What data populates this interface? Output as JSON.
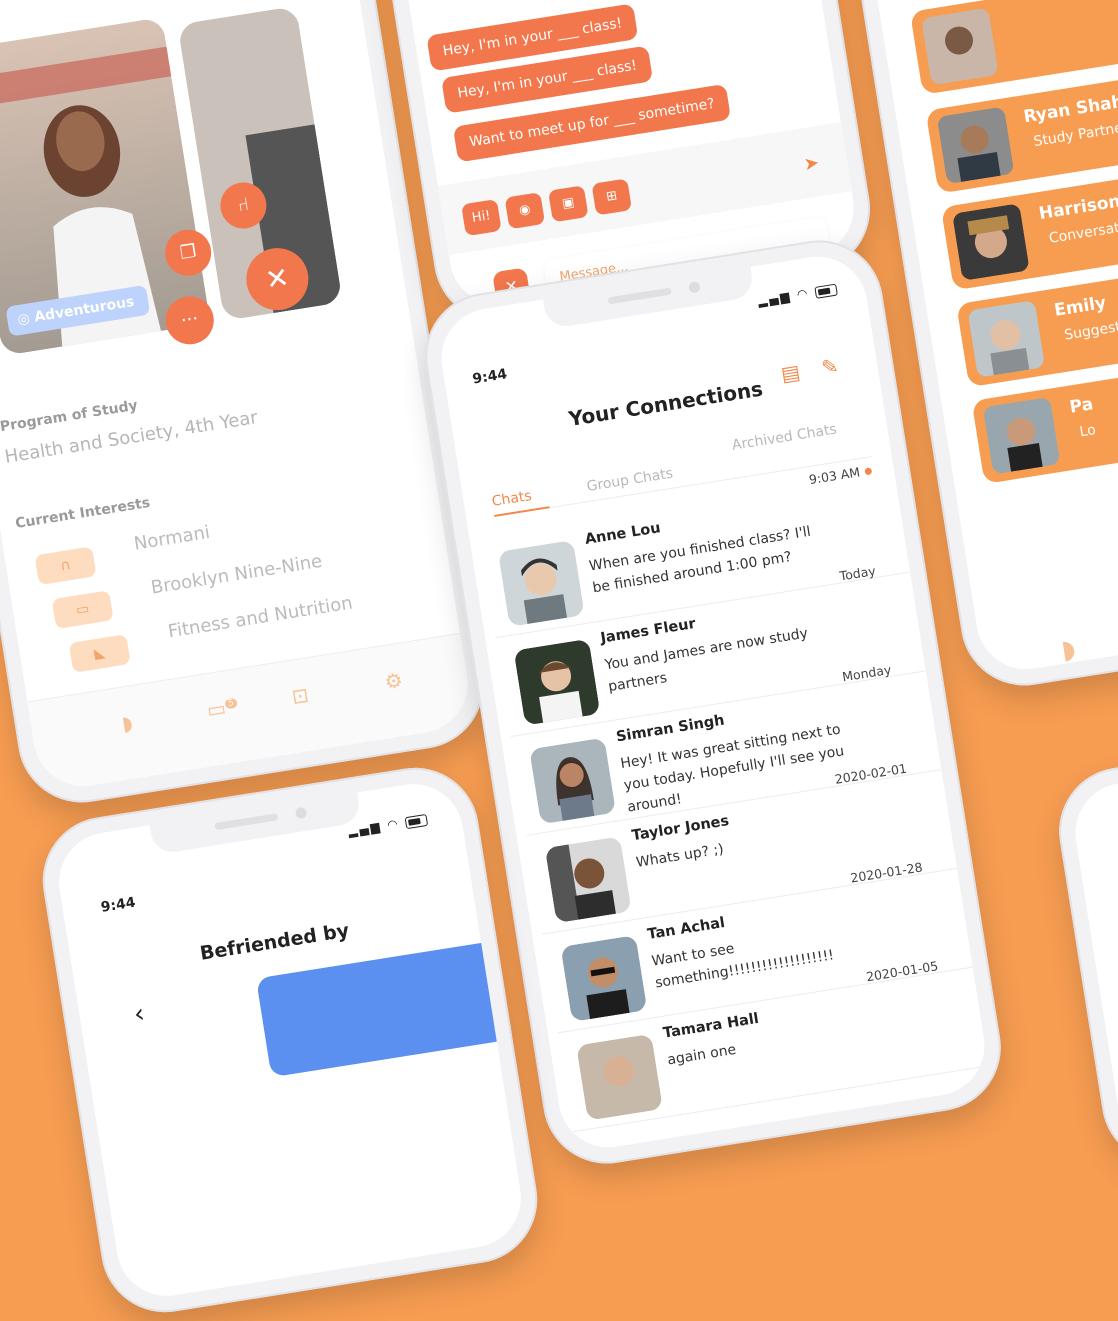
{
  "colors": {
    "background": "#f79d52",
    "accent": "#f2774d",
    "accent_light": "#fddcbf",
    "chip_blue": "#bdd3fb",
    "blue_panel": "#5b8ff0"
  },
  "profile": {
    "tag": "Adventurous",
    "program_label": "Program of Study",
    "program_value": "Health and Society, 4th Year",
    "interests_label": "Current Interests",
    "interests": [
      {
        "icon": "headphones-icon",
        "label": "Normani"
      },
      {
        "icon": "tv-icon",
        "label": "Brooklyn Nine-Nine"
      },
      {
        "icon": "sneaker-icon",
        "label": "Fitness and Nutrition"
      }
    ],
    "nav_badge": "5"
  },
  "compose": {
    "bubbles": [
      "Hey, I'm in your ___ class!",
      "Want to meet up for ___ sometime?"
    ],
    "partial_bubble": "Hey, I'm in your ___ class!",
    "tools": [
      "Hi!",
      "camera-icon",
      "image-icon",
      "file-plus-icon"
    ],
    "input_placeholder": "Message..."
  },
  "suggestions": [
    {
      "name": "Ryan Shah",
      "subtitle": "Study Partner"
    },
    {
      "name": "Harrison",
      "subtitle": "Conversation"
    },
    {
      "name": "Emily",
      "subtitle": "Suggested"
    },
    {
      "name": "Pa",
      "subtitle": "Lo"
    }
  ],
  "connections": {
    "time": "9:44",
    "title": "Your Connections",
    "tabs": [
      "Chats",
      "Group Chats",
      "Archived Chats"
    ],
    "chats": [
      {
        "name": "Anne Lou",
        "message": "When are you finished class? I'll be finished around 1:00 pm?",
        "time": "9:03 AM",
        "unread": true
      },
      {
        "name": "James Fleur",
        "message": "You and James are now study partners",
        "time": "Today",
        "unread": false
      },
      {
        "name": "Simran Singh",
        "message": "Hey! It was great sitting next to you today. Hopefully I'll see you around!",
        "time": "Monday",
        "unread": false
      },
      {
        "name": "Taylor Jones",
        "message": "Whats up? ;)",
        "time": "2020-02-01",
        "unread": false
      },
      {
        "name": "Tan Achal",
        "message": "Want to see something!!!!!!!!!!!!!!!!!!!",
        "time": "2020-01-28",
        "unread": false
      },
      {
        "name": "Tamara Hall",
        "message": "again one",
        "time": "2020-01-05",
        "unread": false
      }
    ]
  },
  "befriended": {
    "time": "9:44",
    "title": "Befriended by",
    "back": "‹"
  }
}
